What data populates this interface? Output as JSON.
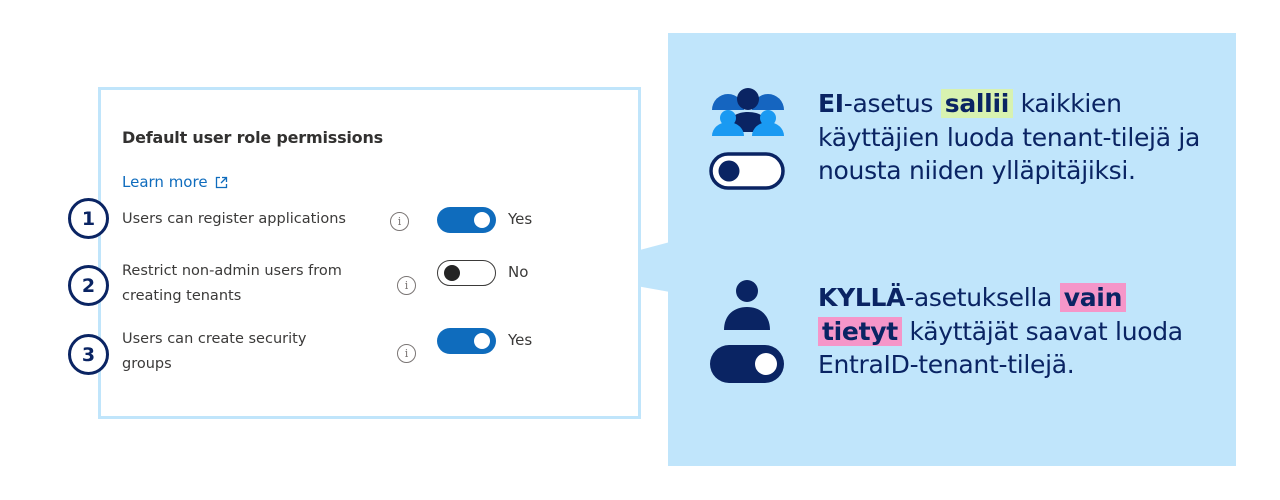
{
  "settings_card": {
    "title": "Default user role permissions",
    "learn_more_label": "Learn more",
    "learn_more_icon": "external-link-icon",
    "rows": [
      {
        "number": "1",
        "label": "Users can register applications",
        "info_icon": "info-icon",
        "toggle_on": true,
        "state_label": "Yes"
      },
      {
        "number": "2",
        "label": "Restrict non-admin users from creating tenants",
        "info_icon": "info-icon",
        "toggle_on": false,
        "state_label": "No"
      },
      {
        "number": "3",
        "label": "Users can create security groups",
        "info_icon": "info-icon",
        "toggle_on": true,
        "state_label": "Yes"
      }
    ]
  },
  "explanation_panel": {
    "no_setting": {
      "icon": "user-group-icon",
      "toggle_icon": "toggle-off-icon",
      "keyword": "EI",
      "text_1": "-asetus ",
      "highlight": "sallii",
      "text_2": " kaikkien käyttäjien luoda tenant-tilejä ja nousta niiden ylläpitäjiksi."
    },
    "yes_setting": {
      "icon": "single-user-icon",
      "toggle_icon": "toggle-on-icon",
      "keyword": "KYLLÄ",
      "text_1": "-asetuksella ",
      "highlight_1": "vain",
      "highlight_2": "tietyt",
      "text_2": " käyttäjät saavat luoda EntraID-tenant-tilejä."
    }
  },
  "colors": {
    "panel_bg": "#c0e5fb",
    "navy": "#0a2463",
    "toggle_blue": "#0f6cbd",
    "highlight_green": "#d8f2b0",
    "highlight_pink": "#f596c9"
  }
}
